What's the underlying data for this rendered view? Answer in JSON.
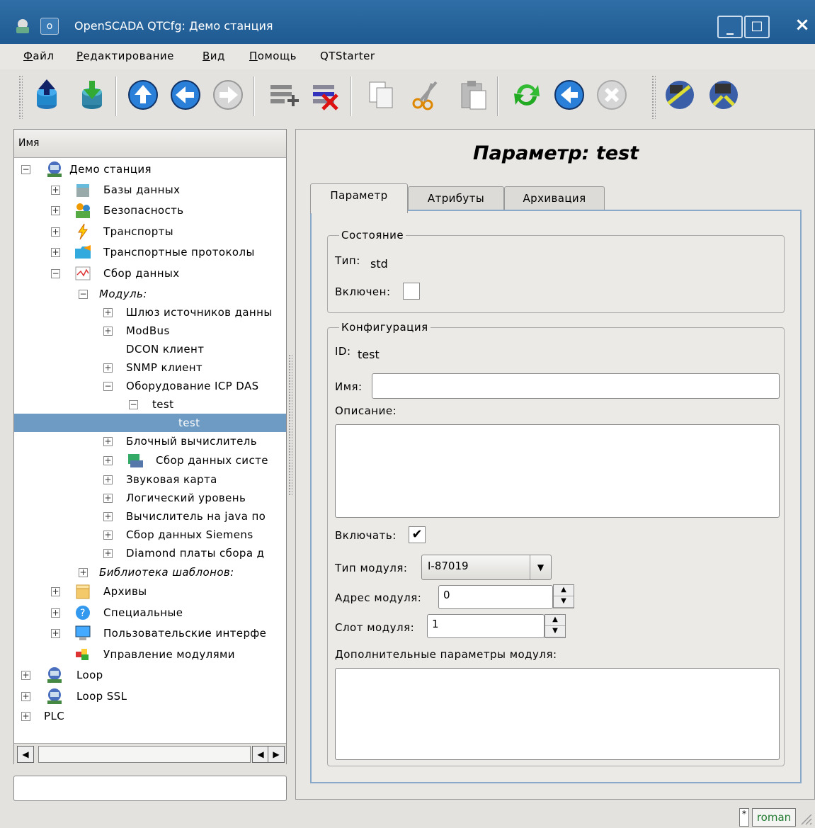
{
  "window": {
    "title": "OpenSCADA QTCfg: Демо станция",
    "menu_btn": "o",
    "min_btn": "_",
    "max_btn": "□",
    "close_btn": "×"
  },
  "menubar": {
    "items": [
      {
        "hotkey": "Ф",
        "rest": "айл"
      },
      {
        "hotkey": "Р",
        "rest": "едактирование"
      },
      {
        "hotkey": "В",
        "rest": "ид"
      },
      {
        "hotkey": "П",
        "rest": "омощь"
      },
      {
        "hotkey": "",
        "rest": "QTStarter"
      }
    ]
  },
  "toolbar": {
    "icons": [
      "db-load-icon",
      "db-save-icon",
      "up-icon",
      "back-icon",
      "forward-icon",
      "add-item-icon",
      "delete-item-icon",
      "copy-icon",
      "cut-icon",
      "paste-icon",
      "refresh-icon",
      "start-icon",
      "stop-icon",
      "vision-icon",
      "config-icon"
    ]
  },
  "tree": {
    "header": "Имя",
    "rows": [
      {
        "label": "Демо станция"
      },
      {
        "label": "Базы данных"
      },
      {
        "label": "Безопасность"
      },
      {
        "label": "Транспорты"
      },
      {
        "label": "Транспортные протоколы"
      },
      {
        "label": "Сбор данных"
      },
      {
        "label": "Модуль:"
      },
      {
        "label": "Шлюз источников данны"
      },
      {
        "label": "ModBus"
      },
      {
        "label": "DCON клиент"
      },
      {
        "label": "SNMP клиент"
      },
      {
        "label": "Оборудование ICP DAS"
      },
      {
        "label": "test"
      },
      {
        "label": "test"
      },
      {
        "label": "Блочный вычислитель"
      },
      {
        "label": "Сбор данных систе"
      },
      {
        "label": "Звуковая карта"
      },
      {
        "label": "Логический уровень"
      },
      {
        "label": "Вычислитель на java по"
      },
      {
        "label": "Сбор данных Siemens"
      },
      {
        "label": "Diamond платы сбора д"
      },
      {
        "label": "Библиотека шаблонов:"
      },
      {
        "label": "Архивы"
      },
      {
        "label": "Специальные"
      },
      {
        "label": "Пользовательские интерфе"
      },
      {
        "label": "Управление модулями"
      },
      {
        "label": "Loop"
      },
      {
        "label": "Loop SSL"
      },
      {
        "label": "PLC"
      }
    ]
  },
  "main": {
    "title": "Параметр: test",
    "tabs": [
      {
        "label": "Параметр"
      },
      {
        "label": "Атрибуты"
      },
      {
        "label": "Архивация"
      }
    ],
    "state_group": {
      "title": "Состояние",
      "type_label": "Тип:",
      "type_value": "std",
      "enabled_label": "Включен:"
    },
    "config_group": {
      "title": "Конфигурация",
      "id_label": "ID:",
      "id_value": "test",
      "name_label": "Имя:",
      "name_value": "",
      "desc_label": "Описание:",
      "desc_value": "",
      "enable_label": "Включать:",
      "enable_checked": "✔",
      "module_type_label": "Тип модуля:",
      "module_type_value": "I-87019",
      "module_addr_label": "Адрес модуля:",
      "module_addr_value": "0",
      "module_slot_label": "Слот модуля:",
      "module_slot_value": "1",
      "extra_label": "Дополнительные параметры модуля:",
      "extra_value": ""
    }
  },
  "statusbar": {
    "lang": "roman",
    "lang_marker": "*"
  }
}
